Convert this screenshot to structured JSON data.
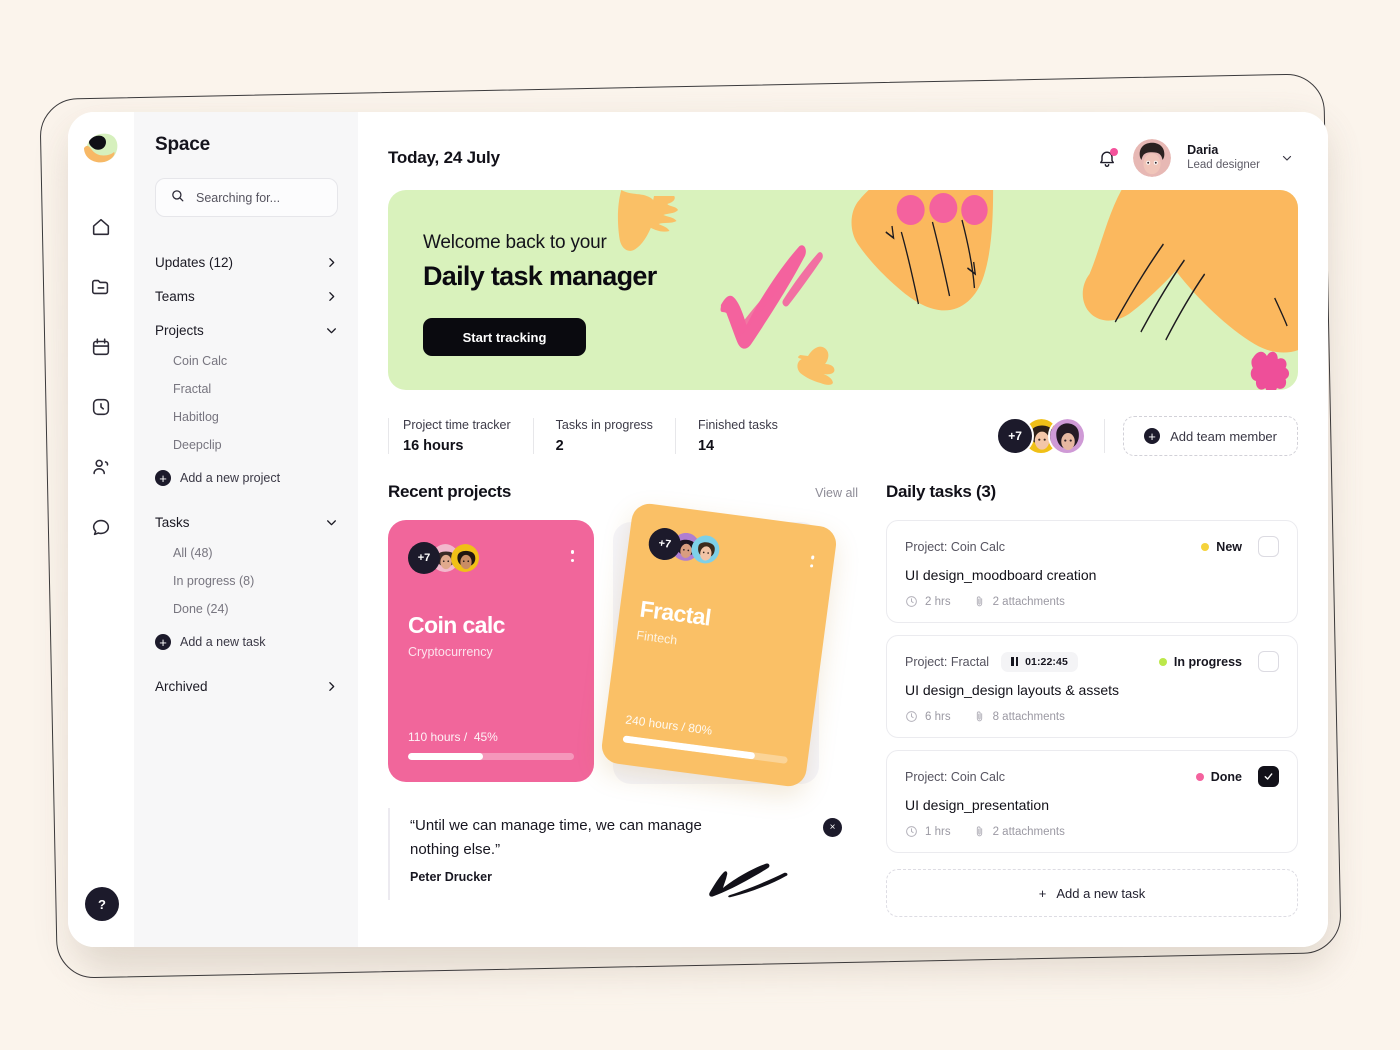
{
  "brand": {
    "logo_name": "space-logo",
    "workspace": "Space"
  },
  "search": {
    "placeholder": "Searching for...",
    "value": ""
  },
  "rail": {
    "icons": [
      "home-icon",
      "folder-minus-icon",
      "calendar-icon",
      "clock-icon",
      "users-icon",
      "chat-icon"
    ],
    "help_label": "?"
  },
  "sidebar": {
    "groups": [
      {
        "label": "Updates (12)",
        "chevron": "chevron-right-icon"
      },
      {
        "label": "Teams",
        "chevron": "chevron-right-icon"
      },
      {
        "label": "Projects",
        "chevron": "chevron-down-icon"
      }
    ],
    "projects": [
      "Coin Calc",
      "Fractal",
      "Habitlog",
      "Deepclip"
    ],
    "add_project": "Add a new project",
    "tasks_label": "Tasks",
    "tasks_chevron": "chevron-down-icon",
    "task_filters": [
      "All (48)",
      "In progress (8)",
      "Done (24)"
    ],
    "add_task": "Add a new task",
    "archived": "Archived",
    "archived_chevron": "chevron-right-icon"
  },
  "header": {
    "date": "Today, 24 July",
    "bell": "bell-icon",
    "user_name": "Daria",
    "user_role": "Lead designer",
    "dropdown": "chevron-down-icon"
  },
  "banner": {
    "kicker": "Welcome back to your",
    "title": "Daily task manager",
    "cta": "Start tracking",
    "bg": "#d9f2bc",
    "accent_orange": "#fac066",
    "accent_pink": "#f4629e"
  },
  "stats": [
    {
      "label": "Project time tracker",
      "value": "16 hours"
    },
    {
      "label": "Tasks in progress",
      "value": "2"
    },
    {
      "label": "Finished tasks",
      "value": "14"
    }
  ],
  "team": {
    "overflow": "+7",
    "add_member": "Add team member"
  },
  "projects_section": {
    "title": "Recent projects",
    "view_all": "View all",
    "cards": [
      {
        "name": "Coin calc",
        "category": "Cryptocurrency",
        "hours": "110 hours /",
        "percent_label": "45%",
        "percent": 45,
        "color": "#f1669b",
        "overflow": "+7"
      },
      {
        "name": "Fractal",
        "category": "Fintech",
        "hours": "240 hours / 80%",
        "percent_label": "80%",
        "percent": 80,
        "color": "#fac066",
        "overflow": "+7"
      }
    ]
  },
  "quote": {
    "text": "“Until we can manage time, we can manage nothing else.”",
    "author": "Peter Drucker",
    "close": "×"
  },
  "tasks_section": {
    "title": "Daily tasks (3)",
    "add_task": "Add a new task",
    "add_icon": "plus-icon",
    "items": [
      {
        "project": "Project: Coin Calc",
        "title": "UI design_moodboard creation",
        "status": "New",
        "status_color": "#f5d33c",
        "hours": "2 hrs",
        "attachments": "2 attachments",
        "checked": false,
        "timer": null
      },
      {
        "project": "Project: Fractal",
        "title": "UI design_design layouts & assets",
        "status": "In progress",
        "status_color": "#bce84a",
        "hours": "6 hrs",
        "attachments": "8 attachments",
        "checked": false,
        "timer": "01:22:45"
      },
      {
        "project": "Project: Coin Calc",
        "title": "UI design_presentation",
        "status": "Done",
        "status_color": "#f4629e",
        "hours": "1 hrs",
        "attachments": "2 attachments",
        "checked": true,
        "timer": null
      }
    ]
  }
}
